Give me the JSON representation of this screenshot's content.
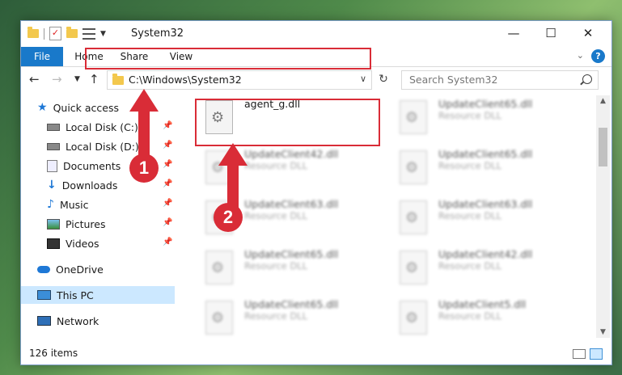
{
  "window": {
    "title": "System32"
  },
  "ribbon": {
    "tabs": [
      "File",
      "Home",
      "Share",
      "View"
    ],
    "help": "?"
  },
  "controls": {
    "minimize": "—",
    "maximize": "☐",
    "close": "✕"
  },
  "address": {
    "path": "C:\\Windows\\System32"
  },
  "search": {
    "placeholder": "Search System32"
  },
  "sidebar": {
    "items": [
      {
        "label": "Quick access",
        "icon": "star-icon"
      },
      {
        "label": "Local Disk (C:)",
        "icon": "disk-icon",
        "pinned": true
      },
      {
        "label": "Local Disk (D:)",
        "icon": "disk-icon",
        "pinned": true
      },
      {
        "label": "Documents",
        "icon": "document-icon",
        "pinned": true
      },
      {
        "label": "Downloads",
        "icon": "download-icon",
        "pinned": true
      },
      {
        "label": "Music",
        "icon": "music-icon",
        "pinned": true
      },
      {
        "label": "Pictures",
        "icon": "pictures-icon",
        "pinned": true
      },
      {
        "label": "Videos",
        "icon": "videos-icon",
        "pinned": true
      },
      {
        "label": "OneDrive",
        "icon": "cloud-icon"
      },
      {
        "label": "This PC",
        "icon": "computer-icon",
        "selected": true
      },
      {
        "label": "Network",
        "icon": "network-icon"
      }
    ]
  },
  "files": [
    {
      "name": "agent_g.dll",
      "type": ""
    },
    {
      "name": "UpdateClient65.dll",
      "type": "Resource DLL"
    },
    {
      "name": "UpdateClient42.dll",
      "type": "Resource DLL"
    },
    {
      "name": "UpdateClient65.dll",
      "type": "Resource DLL"
    },
    {
      "name": "UpdateClient63.dll",
      "type": "Resource DLL"
    },
    {
      "name": "UpdateClient63.dll",
      "type": "Resource DLL"
    },
    {
      "name": "UpdateClient65.dll",
      "type": "Resource DLL"
    },
    {
      "name": "UpdateClient42.dll",
      "type": "Resource DLL"
    },
    {
      "name": "UpdateClient65.dll",
      "type": "Resource DLL"
    },
    {
      "name": "UpdateClient5.dll",
      "type": "Resource DLL"
    }
  ],
  "status": {
    "item_count": "126 items"
  },
  "annotations": {
    "marker1": "1",
    "marker2": "2",
    "color": "#d92c37"
  }
}
